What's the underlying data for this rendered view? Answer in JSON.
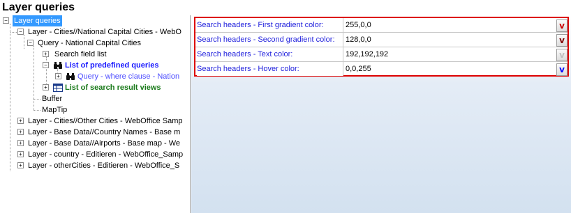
{
  "page_title": "Layer queries",
  "tree": {
    "root": "Layer queries",
    "layer_cities": "Layer - Cities//National Capital Cities - WebO",
    "query_capital": "Query - National Capital Cities",
    "search_field_list": "Search field list",
    "predefined_queries": "List of predefined queries",
    "query_where": "Query - where clause - Nation",
    "search_result_views": "List of search result views",
    "buffer": "Buffer",
    "maptip": "MapTip",
    "layer_other_cities": "Layer - Cities//Other Cities - WebOffice Samp",
    "layer_country_names": "Layer - Base Data//Country Names - Base m",
    "layer_airports": "Layer - Base Data//Airports - Base map - We",
    "layer_country": "Layer - country - Editieren - WebOffice_Samp",
    "layer_othercities": "Layer - otherCities - Editieren - WebOffice_S"
  },
  "properties": [
    {
      "name": "Search headers - First gradient color:",
      "value": "255,0,0",
      "dropdown_glyph": "v",
      "dropdown_color": "#cc0000"
    },
    {
      "name": "Search headers - Second gradient color:",
      "value": "128,0,0",
      "dropdown_glyph": "v",
      "dropdown_color": "#800000"
    },
    {
      "name": "Search headers - Text color:",
      "value": "192,192,192",
      "dropdown_glyph": "v",
      "dropdown_color": "#c0c0c0"
    },
    {
      "name": "Search headers - Hover color:",
      "value": "0,0,255",
      "dropdown_glyph": "v",
      "dropdown_color": "#0000ff"
    }
  ]
}
